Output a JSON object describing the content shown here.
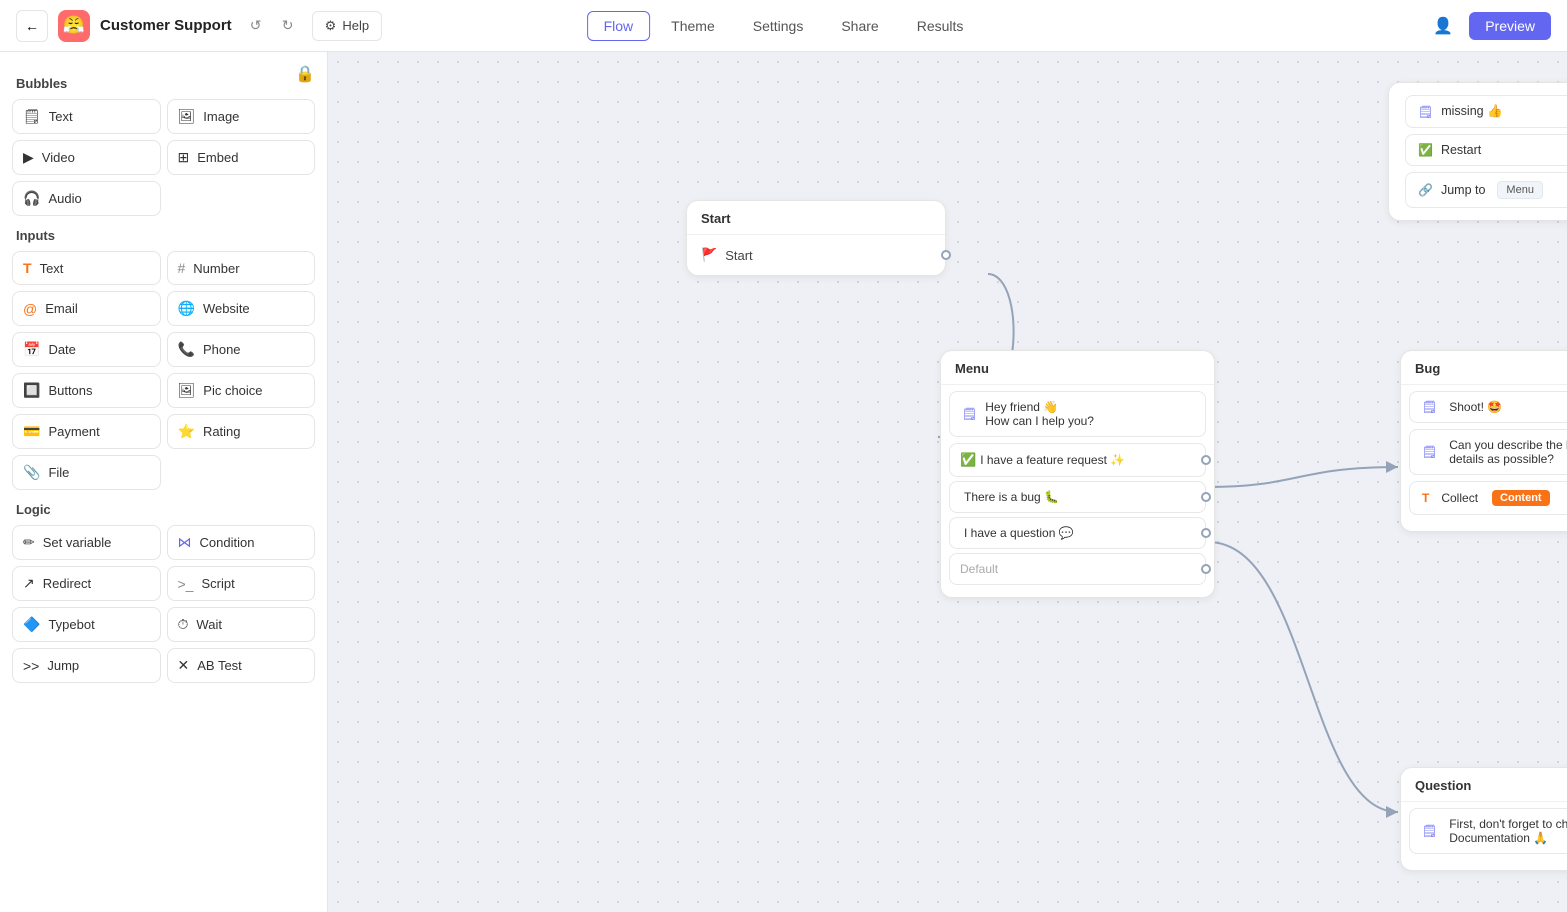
{
  "header": {
    "back_label": "←",
    "app_name": "Customer Support",
    "undo_label": "↺",
    "redo_label": "↻",
    "help_label": "Help",
    "nav_items": [
      "Flow",
      "Theme",
      "Settings",
      "Share",
      "Results"
    ],
    "active_nav": "Flow",
    "preview_label": "Preview"
  },
  "sidebar": {
    "bubbles_title": "Bubbles",
    "bubbles": [
      {
        "label": "Text",
        "icon": "🗒"
      },
      {
        "label": "Image",
        "icon": "🖼"
      },
      {
        "label": "Video",
        "icon": "▶"
      },
      {
        "label": "Embed",
        "icon": "⊞"
      },
      {
        "label": "Audio",
        "icon": "🎧"
      }
    ],
    "inputs_title": "Inputs",
    "inputs": [
      {
        "label": "Text",
        "icon": "T"
      },
      {
        "label": "Number",
        "icon": "#"
      },
      {
        "label": "Email",
        "icon": "@"
      },
      {
        "label": "Website",
        "icon": "🌐"
      },
      {
        "label": "Date",
        "icon": "📅"
      },
      {
        "label": "Phone",
        "icon": "📞"
      },
      {
        "label": "Buttons",
        "icon": "🔲"
      },
      {
        "label": "Pic choice",
        "icon": "🖼"
      },
      {
        "label": "Payment",
        "icon": "💳"
      },
      {
        "label": "Rating",
        "icon": "⭐"
      },
      {
        "label": "File",
        "icon": "📎"
      }
    ],
    "logic_title": "Logic",
    "logic": [
      {
        "label": "Set variable",
        "icon": "✏"
      },
      {
        "label": "Condition",
        "icon": "⋈"
      },
      {
        "label": "Redirect",
        "icon": "↗"
      },
      {
        "label": "Script",
        "icon": ">_"
      },
      {
        "label": "Typebot",
        "icon": "🔷"
      },
      {
        "label": "Wait",
        "icon": "⏱"
      },
      {
        "label": "Jump",
        "icon": ">>"
      },
      {
        "label": "AB Test",
        "icon": "✕"
      }
    ]
  },
  "nodes": {
    "start": {
      "label": "Start",
      "inner_label": "Start"
    },
    "menu": {
      "title": "Menu",
      "message": "Hey friend 👋\nHow can I help you?",
      "choices": [
        {
          "text": "I have a feature request ✨"
        },
        {
          "text": "There is a bug 🐛"
        },
        {
          "text": "I have a question 💬"
        },
        {
          "text": "Default"
        }
      ]
    },
    "bug": {
      "title": "Bug",
      "rows": [
        {
          "type": "message",
          "text": "Shoot! 🤩"
        },
        {
          "type": "message",
          "text": "Can you describe the bug with as many details as possible?"
        },
        {
          "type": "collect",
          "label": "Collect",
          "badge": "Content"
        }
      ]
    },
    "top_right": {
      "rows": [
        {
          "type": "text",
          "text": "missing 👍"
        },
        {
          "type": "restart",
          "text": "Restart"
        },
        {
          "type": "jump",
          "text": "Jump to",
          "target": "Menu"
        }
      ]
    },
    "question": {
      "title": "Question",
      "rows": [
        {
          "type": "message",
          "text": "First, don't forget to check out the Documentation 🙏"
        }
      ]
    }
  }
}
